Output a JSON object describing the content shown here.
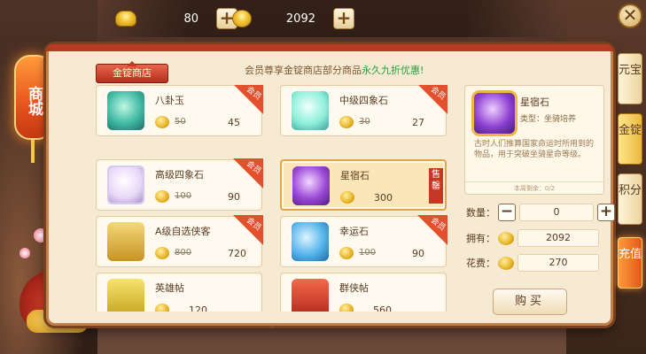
{
  "topbar": {
    "ingot": {
      "icon": "gold-ingot-icon",
      "value": "80"
    },
    "coin": {
      "icon": "gold-coin-icon",
      "value": "2092"
    },
    "plus": "+",
    "close": "✕"
  },
  "left": {
    "sign": "商城"
  },
  "store": {
    "tab": "金锭商店",
    "notice_prefix": "会员尊享金锭商店部分商品",
    "notice_highlight": "永久九折优惠!"
  },
  "items": [
    {
      "name": "八卦玉",
      "old_price": "50",
      "price": "45",
      "badge": "会员",
      "icon": "green-jade-icon"
    },
    {
      "name": "中级四象石",
      "old_price": "30",
      "price": "27",
      "badge": "会员",
      "icon": "mint-crystal-icon"
    },
    {
      "name": "高级四象石",
      "old_price": "100",
      "price": "90",
      "badge": "会员",
      "icon": "pink-crystal-icon"
    },
    {
      "name": "星宿石",
      "price": "300",
      "badge": "售罄",
      "icon": "purple-orb-icon"
    },
    {
      "name": "A级自选侠客",
      "old_price": "800",
      "price": "720",
      "badge": "会员",
      "icon": "hero-token-icon"
    },
    {
      "name": "幸运石",
      "old_price": "100",
      "price": "90",
      "badge": "会员",
      "icon": "blue-stone-icon"
    },
    {
      "name": "英雄帖",
      "price": "120",
      "icon": "yellow-scroll-icon"
    },
    {
      "name": "群侠帖",
      "price": "560",
      "icon": "red-scroll-icon"
    }
  ],
  "detail": {
    "name": "星宿石",
    "type": "类型：坐骑培养",
    "desc": "古时人们推算国家命运时所用到的物品，用于突破坐骑星命等级。",
    "limit": "本周剩余：0/2"
  },
  "purchase": {
    "qty_label": "数量：",
    "qty": "0",
    "minus": "−",
    "plus": "+",
    "own_label": "拥有：",
    "own": "2092",
    "cost_label": "花费：",
    "cost": "270",
    "buy": "购买"
  },
  "side_tabs": [
    "元宝",
    "金锭",
    "积分",
    "充值"
  ],
  "scroll_hint": "⌄"
}
